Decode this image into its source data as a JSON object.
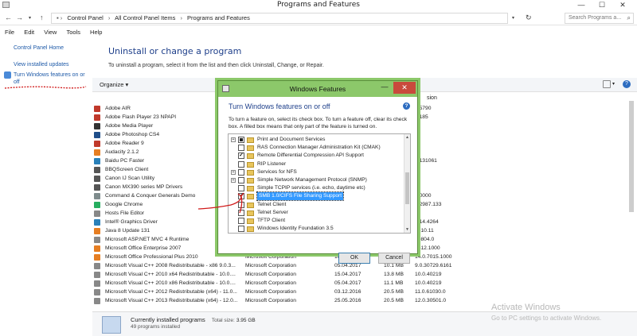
{
  "window": {
    "title": "Programs and Features",
    "min": "—",
    "max": "☐",
    "close": "✕"
  },
  "address": {
    "crumbs": [
      "Control Panel",
      "All Control Panel Items",
      "Programs and Features"
    ],
    "search_placeholder": "Search Programs a..."
  },
  "menu": [
    "File",
    "Edit",
    "View",
    "Tools",
    "Help"
  ],
  "left": {
    "home": "Control Panel Home",
    "updates": "View installed updates",
    "features": "Turn Windows features on or off"
  },
  "main": {
    "title": "Uninstall or change a program",
    "desc": "To uninstall a program, select it from the list and then click Uninstall, Change, or Repair.",
    "organize": "Organize ▾",
    "version_header_fragment": "sion"
  },
  "programs": [
    {
      "name": "Adobe AIR",
      "publisher": "",
      "date": "",
      "size": "",
      "version": "0.5790",
      "color": "#c0392b"
    },
    {
      "name": "Adobe Flash Player 23 NPAPI",
      "publisher": "",
      "date": "",
      "size": "",
      "version": "0.185",
      "color": "#c0392b"
    },
    {
      "name": "Adobe Media Player",
      "publisher": "",
      "date": "",
      "size": "",
      "version": "",
      "color": "#333333"
    },
    {
      "name": "Adobe Photoshop CS4",
      "publisher": "",
      "date": "",
      "size": "",
      "version": "",
      "color": "#1f4e8a"
    },
    {
      "name": "Adobe Reader 9",
      "publisher": "",
      "date": "",
      "size": "",
      "version": "",
      "color": "#c0392b"
    },
    {
      "name": "Audacity 2.1.2",
      "publisher": "",
      "date": "",
      "size": "",
      "version": "",
      "color": "#e67e22"
    },
    {
      "name": "Baidu PC Faster",
      "publisher": "",
      "date": "",
      "size": "",
      "version": "3.131061",
      "color": "#2980b9"
    },
    {
      "name": "BBQScreen Client",
      "publisher": "",
      "date": "",
      "size": "",
      "version": "",
      "color": "#555555"
    },
    {
      "name": "Canon IJ Scan Utility",
      "publisher": "",
      "date": "",
      "size": "",
      "version": "",
      "color": "#555555"
    },
    {
      "name": "Canon MX390 series MP Drivers",
      "publisher": "",
      "date": "",
      "size": "",
      "version": "",
      "color": "#555555"
    },
    {
      "name": "Command & Conquer Generals Demo",
      "publisher": "",
      "date": "",
      "size": "",
      "version": "0.0000",
      "color": "#7f8c8d"
    },
    {
      "name": "Google Chrome",
      "publisher": "",
      "date": "",
      "size": "",
      "version": "0.2987.133",
      "color": "#27ae60"
    },
    {
      "name": "Hosts File Editor",
      "publisher": "",
      "date": "",
      "size": "",
      "version": "",
      "color": "#888888"
    },
    {
      "name": "Intel® Graphics Driver",
      "publisher": "",
      "date": "",
      "size": "",
      "version": "8.14.4264",
      "color": "#2980b9"
    },
    {
      "name": "Java 8 Update 131",
      "publisher": "",
      "date": "",
      "size": "",
      "version": "1310.11",
      "color": "#e67e22"
    },
    {
      "name": "Microsoft ASP.NET MVC 4 Runtime",
      "publisher": "",
      "date": "",
      "size": "",
      "version": "40804.0",
      "color": "#888888"
    },
    {
      "name": "Microsoft Office Enterprise 2007",
      "publisher": "",
      "date": "",
      "size": "",
      "version": "6612.1000",
      "color": "#e67e22"
    },
    {
      "name": "Microsoft Office Professional Plus 2010",
      "publisher": "Microsoft Corporation",
      "date": "16.04.2017",
      "size": "",
      "version": "14.0.7015.1000",
      "color": "#e67e22"
    },
    {
      "name": "Microsoft Visual C++ 2008 Redistributable - x86 9.0.3...",
      "publisher": "Microsoft Corporation",
      "date": "05.04.2017",
      "size": "10.1 MB",
      "version": "9.0.30729.6161",
      "color": "#888888"
    },
    {
      "name": "Microsoft Visual C++ 2010  x64 Redistributable - 10.0....",
      "publisher": "Microsoft Corporation",
      "date": "15.04.2017",
      "size": "13.8 MB",
      "version": "10.0.40219",
      "color": "#888888"
    },
    {
      "name": "Microsoft Visual C++ 2010  x86 Redistributable - 10.0....",
      "publisher": "Microsoft Corporation",
      "date": "05.04.2017",
      "size": "11.1 MB",
      "version": "10.0.40219",
      "color": "#888888"
    },
    {
      "name": "Microsoft Visual C++ 2012 Redistributable (x64) - 11.0...",
      "publisher": "Microsoft Corporation",
      "date": "03.12.2016",
      "size": "20.5 MB",
      "version": "11.0.61030.0",
      "color": "#888888"
    },
    {
      "name": "Microsoft Visual C++ 2013 Redistributable (x64) - 12.0...",
      "publisher": "Microsoft Corporation",
      "date": "25.05.2016",
      "size": "20.5 MB",
      "version": "12.0.30501.0",
      "color": "#888888"
    }
  ],
  "status": {
    "line1": "Currently installed programs",
    "size_label": "Total size:",
    "size_value": "3.95 GB",
    "line2": "49 programs installed"
  },
  "watermark": {
    "line1": "Activate Windows",
    "line2": "Go to PC settings to activate Windows."
  },
  "dialog": {
    "title": "Windows Features",
    "heading": "Turn Windows features on or off",
    "help": "?",
    "desc": "To turn a feature on, select its check box. To turn a feature off, clear its check box. A filled box means that only part of the feature is turned on.",
    "ok": "OK",
    "cancel": "Cancel",
    "features": [
      {
        "label": "Print and Document Services",
        "state": "partial",
        "expand": "+"
      },
      {
        "label": "RAS Connection Manager Administration Kit (CMAK)",
        "state": "off",
        "expand": ""
      },
      {
        "label": "Remote Differential Compression API Support",
        "state": "on",
        "expand": ""
      },
      {
        "label": "RIP Listener",
        "state": "off",
        "expand": ""
      },
      {
        "label": "Services for NFS",
        "state": "off",
        "expand": "+"
      },
      {
        "label": "Simple Network Management Protocol (SNMP)",
        "state": "off",
        "expand": "+"
      },
      {
        "label": "Simple TCPIP services (i.e. echo, daytime etc)",
        "state": "off",
        "expand": ""
      },
      {
        "label": "SMB 1.0/CIFS File Sharing Support",
        "state": "on",
        "expand": "",
        "selected": true
      },
      {
        "label": "Telnet Client",
        "state": "off",
        "expand": ""
      },
      {
        "label": "Telnet Server",
        "state": "off",
        "expand": ""
      },
      {
        "label": "TFTP Client",
        "state": "off",
        "expand": ""
      },
      {
        "label": "Windows Identity Foundation 3.5",
        "state": "off",
        "expand": ""
      }
    ]
  }
}
